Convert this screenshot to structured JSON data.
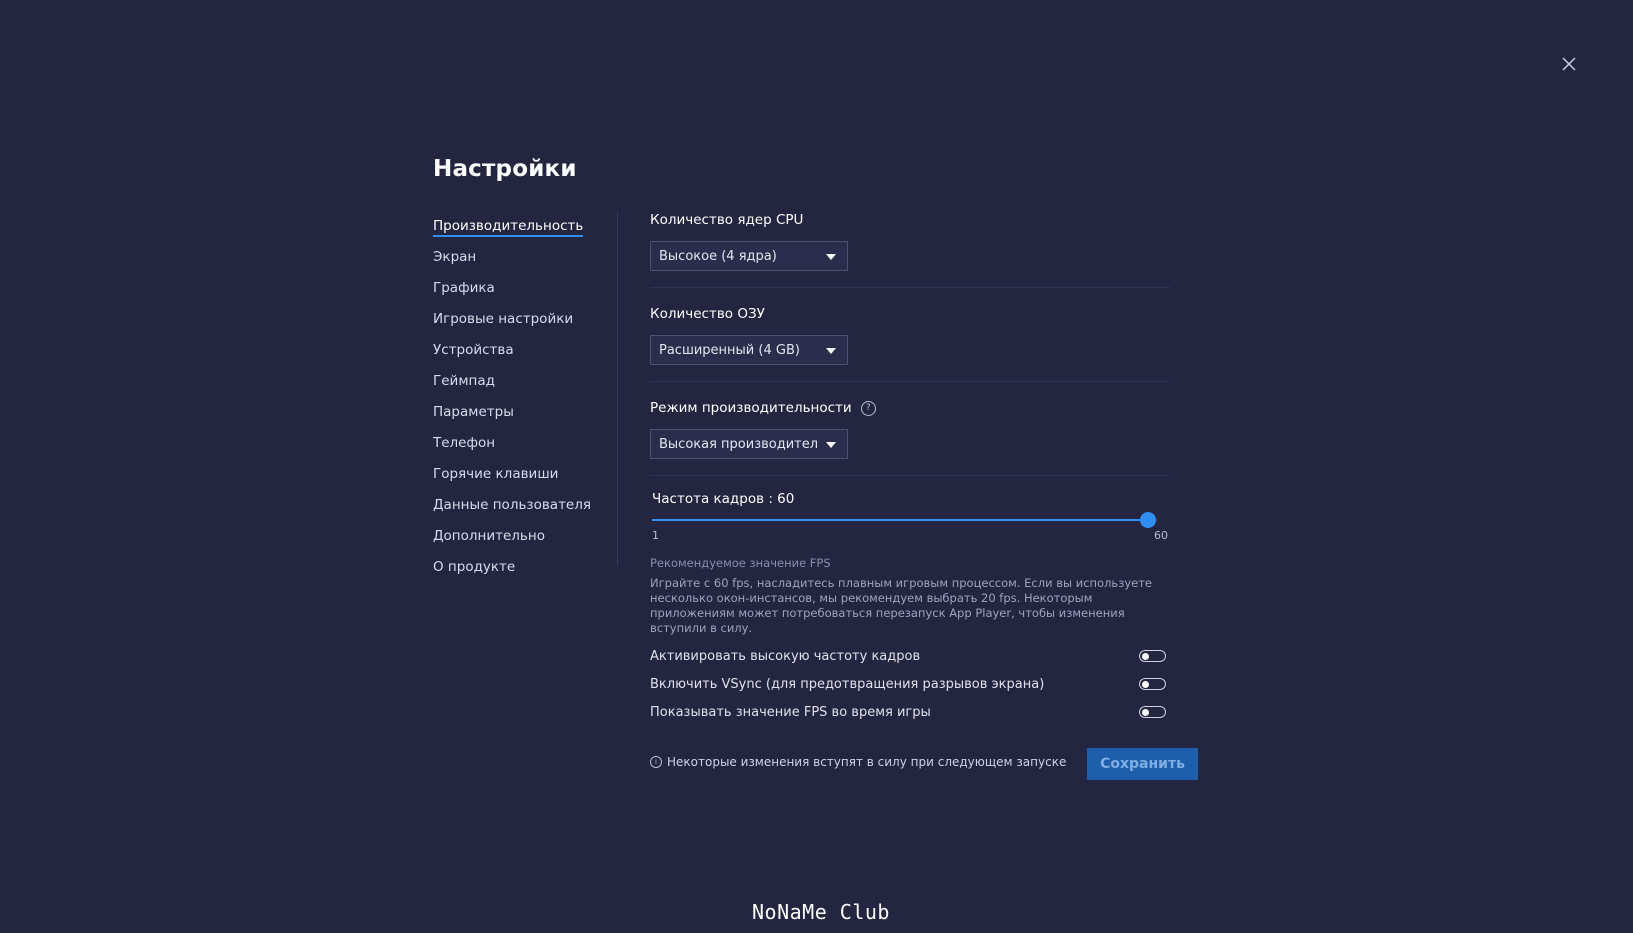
{
  "page": {
    "title": "Настройки",
    "close_icon": "close-icon"
  },
  "sidebar": {
    "items": [
      {
        "label": "Производительность",
        "active": true
      },
      {
        "label": "Экран"
      },
      {
        "label": "Графика"
      },
      {
        "label": "Игровые настройки"
      },
      {
        "label": "Устройства"
      },
      {
        "label": "Геймпад"
      },
      {
        "label": "Параметры"
      },
      {
        "label": "Телефон"
      },
      {
        "label": "Горячие клавиши"
      },
      {
        "label": "Данные пользователя"
      },
      {
        "label": "Дополнительно"
      },
      {
        "label": "О продукте"
      }
    ]
  },
  "performance": {
    "cpu": {
      "label": "Количество ядер CPU",
      "value": "Высокое (4 ядра)"
    },
    "ram": {
      "label": "Количество ОЗУ",
      "value": "Расширенный (4 GB)"
    },
    "mode": {
      "label": "Режим производительности",
      "value": "Высокая производительность"
    },
    "fps": {
      "label": "Частота кадров : 60",
      "value": 60,
      "min": 1,
      "max": 60,
      "min_label": "1",
      "max_label": "60",
      "recommend_title": "Рекомендуемое значение FPS",
      "recommend_text": "Играйте с 60 fps, насладитесь плавным игровым процессом. Если вы используете несколько окон-инстансов, мы рекомендуем выбрать 20 fps. Некоторым приложениям может потребоваться перезапуск App Player, чтобы изменения вступили в силу."
    },
    "toggles": [
      {
        "label": "Активировать высокую частоту кадров",
        "on": false
      },
      {
        "label": "Включить VSync (для предотвращения разрывов экрана)",
        "on": false
      },
      {
        "label": "Показывать значение FPS во время игры",
        "on": false
      }
    ]
  },
  "footer": {
    "note": "Некоторые изменения вступят в силу при следующем запуске",
    "save_label": "Сохранить"
  },
  "watermark": "NoNaMe Club",
  "colors": {
    "background": "#232541",
    "accent": "#2f8ef0",
    "save_button": "#1d5fab"
  }
}
